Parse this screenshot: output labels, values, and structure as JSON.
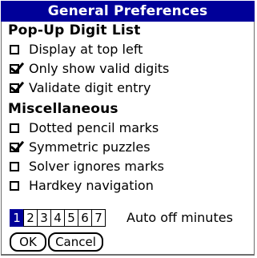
{
  "dialog": {
    "title": "General Preferences"
  },
  "popup_section": {
    "heading": "Pop-Up Digit List",
    "items": [
      {
        "label": "Display at top left",
        "checked": false
      },
      {
        "label": "Only show valid digits",
        "checked": true
      },
      {
        "label": "Validate digit entry",
        "checked": true
      }
    ]
  },
  "misc_section": {
    "heading": "Miscellaneous",
    "items": [
      {
        "label": "Dotted pencil marks",
        "checked": false
      },
      {
        "label": "Symmetric puzzles",
        "checked": true
      },
      {
        "label": "Solver ignores marks",
        "checked": false
      },
      {
        "label": "Hardkey navigation",
        "checked": false
      }
    ]
  },
  "auto_off": {
    "options": [
      "1",
      "2",
      "3",
      "4",
      "5",
      "6",
      "7"
    ],
    "selected": "1",
    "label": "Auto off minutes"
  },
  "buttons": {
    "ok": "OK",
    "cancel": "Cancel"
  },
  "colors": {
    "title_bg": "#000099",
    "selected_bg": "#000099"
  }
}
